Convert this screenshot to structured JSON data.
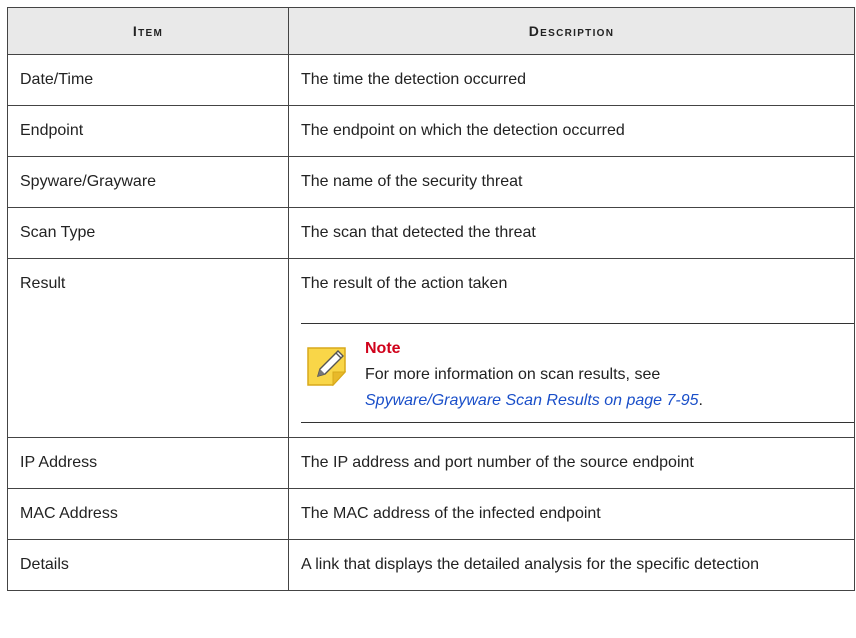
{
  "table": {
    "headers": {
      "item": "Item",
      "description": "Description"
    },
    "rows": [
      {
        "item": "Date/Time",
        "description": "The time the detection occurred"
      },
      {
        "item": "Endpoint",
        "description": "The endpoint on which the detection occurred"
      },
      {
        "item": "Spyware/Grayware",
        "description": "The name of the security threat"
      },
      {
        "item": "Scan Type",
        "description": "The scan that detected the threat"
      },
      {
        "item": "Result",
        "description": "The result of the action taken"
      },
      {
        "item": "IP Address",
        "description": "The IP address and port number of the source endpoint"
      },
      {
        "item": "MAC Address",
        "description": "The MAC address of the infected endpoint"
      },
      {
        "item": "Details",
        "description": "A link that displays the detailed analysis for the specific detection"
      }
    ]
  },
  "note": {
    "title": "Note",
    "text": "For more information on scan results, see",
    "link_text": "Spyware/Grayware Scan Results on page 7-95",
    "suffix": ".",
    "icon": "note-pencil-icon"
  }
}
